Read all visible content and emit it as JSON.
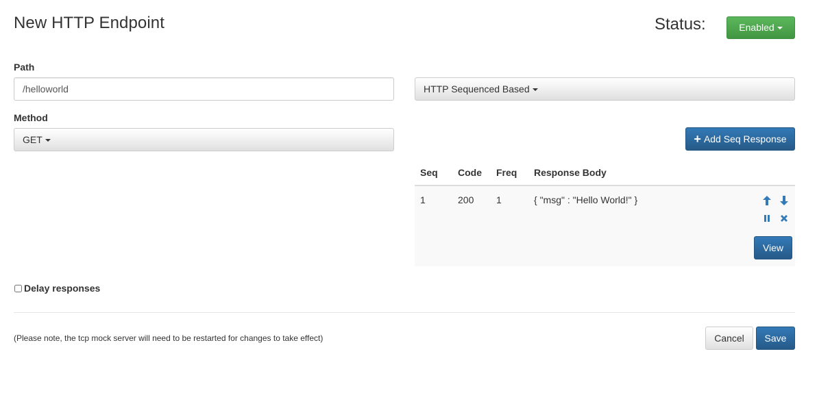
{
  "header": {
    "title": "New HTTP Endpoint",
    "status_label": "Status:",
    "status_value": "Enabled"
  },
  "form": {
    "path_label": "Path",
    "path_value": "/helloworld",
    "mode_value": "HTTP Sequenced Based",
    "method_label": "Method",
    "method_value": "GET",
    "add_seq_label": "Add Seq Response",
    "delay_label": "Delay responses",
    "delay_checked": false
  },
  "table": {
    "headers": [
      "Seq",
      "Code",
      "Freq",
      "Response Body"
    ],
    "rows": [
      {
        "seq": "1",
        "code": "200",
        "freq": "1",
        "body": "{ \"msg\" : \"Hello World!\" }",
        "view_label": "View"
      }
    ]
  },
  "footer": {
    "note": "(Please note, the tcp mock server will need to be restarted for changes to take effect)",
    "cancel_label": "Cancel",
    "save_label": "Save"
  },
  "colors": {
    "success": "#5cb85c",
    "primary": "#337ab7"
  },
  "icons": [
    "arrow-up-icon",
    "arrow-down-icon",
    "pause-icon",
    "remove-icon",
    "plus-icon",
    "caret-down-icon"
  ]
}
